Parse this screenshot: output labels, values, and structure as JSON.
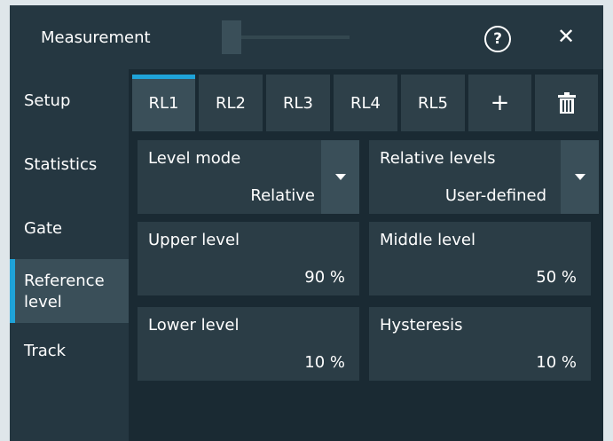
{
  "dialog": {
    "title": "Measurement",
    "help_icon": "question-circle-icon",
    "close_icon": "close-x-icon"
  },
  "sidebar": {
    "items": [
      {
        "label": "Setup"
      },
      {
        "label": "Statistics"
      },
      {
        "label": "Gate"
      },
      {
        "label": "Reference level",
        "label_line1": "Reference",
        "label_line2": "level",
        "active": true
      },
      {
        "label": "Track"
      }
    ]
  },
  "tabs": {
    "items": [
      "RL1",
      "RL2",
      "RL3",
      "RL4",
      "RL5"
    ],
    "active": "RL1",
    "add_label": "+",
    "delete_icon": "trash-icon"
  },
  "fields": {
    "level_mode": {
      "label": "Level mode",
      "value": "Relative"
    },
    "relative_levels": {
      "label": "Relative levels",
      "value": "User-defined"
    },
    "upper_level": {
      "label": "Upper level",
      "value": "90 %"
    },
    "middle_level": {
      "label": "Middle level",
      "value": "50 %"
    },
    "lower_level": {
      "label": "Lower level",
      "value": "10 %"
    },
    "hysteresis": {
      "label": "Hysteresis",
      "value": "10 %"
    }
  },
  "colors": {
    "accent": "#1fa3d8",
    "background": "#1a2a33",
    "panel": "#253741",
    "field": "#2b3d46"
  }
}
